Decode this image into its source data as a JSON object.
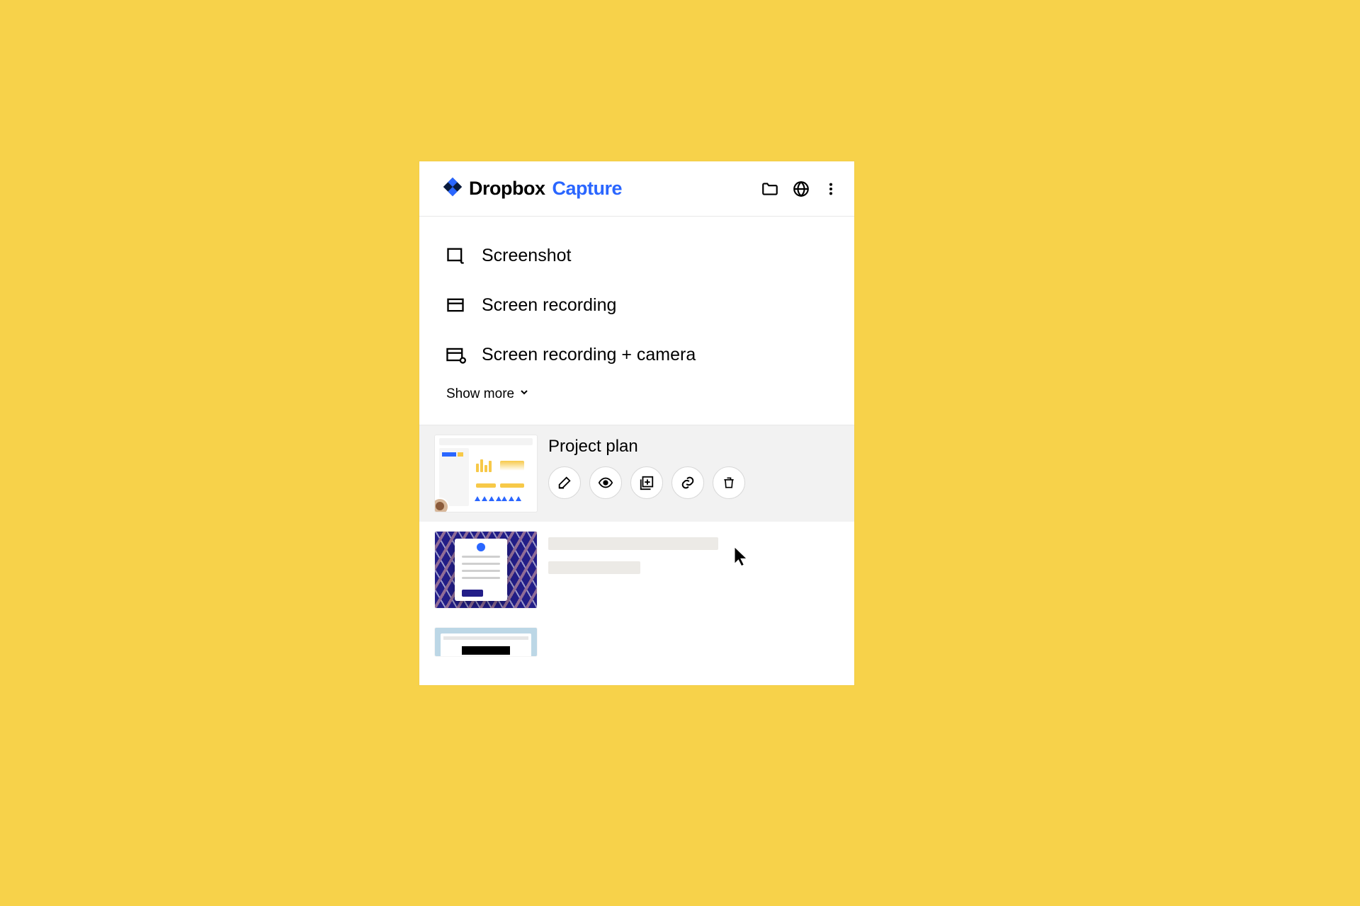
{
  "colors": {
    "accent": "#2a66ff",
    "bg": "#f7d24a"
  },
  "header": {
    "brand_main": "Dropbox",
    "brand_sub": "Capture",
    "icons": {
      "folder": "folder-icon",
      "globe": "globe-icon",
      "more": "more-vertical-icon"
    }
  },
  "options": [
    {
      "id": "screenshot",
      "label": "Screenshot",
      "icon": "screenshot-icon"
    },
    {
      "id": "screen-recording",
      "label": "Screen recording",
      "icon": "screen-recording-icon"
    },
    {
      "id": "screen-recording-camera",
      "label": "Screen recording + camera",
      "icon": "screen-recording-camera-icon"
    }
  ],
  "show_more_label": "Show more",
  "recent": [
    {
      "id": "project-plan",
      "title": "Project plan",
      "hovered": true,
      "actions": [
        {
          "id": "edit",
          "icon": "edit-icon"
        },
        {
          "id": "view",
          "icon": "eye-icon"
        },
        {
          "id": "add",
          "icon": "add-to-collection-icon"
        },
        {
          "id": "link",
          "icon": "link-icon"
        },
        {
          "id": "delete",
          "icon": "trash-icon"
        }
      ]
    },
    {
      "id": "item-2",
      "title": "",
      "hovered": false
    },
    {
      "id": "item-3",
      "title": "",
      "hovered": false
    }
  ]
}
